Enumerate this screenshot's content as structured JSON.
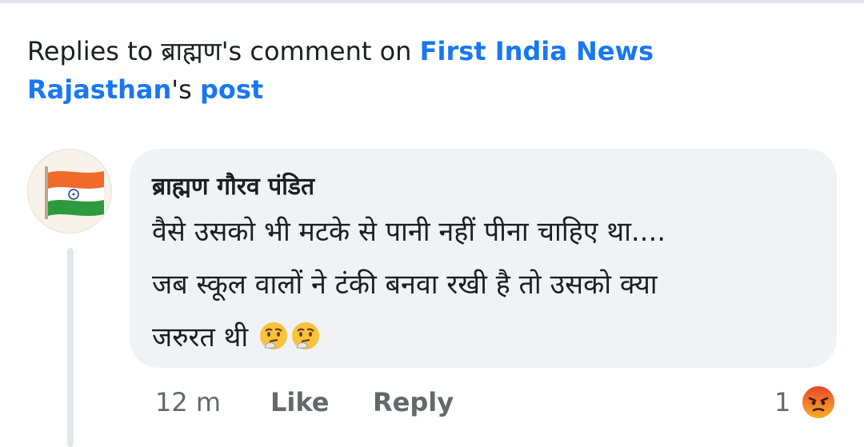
{
  "header": {
    "prefix": "Replies to ब्राह्मण's comment on ",
    "page_name_part1": "First India News",
    "page_name_part2": "Rajasthan",
    "possessive": "'s ",
    "post_link": "post"
  },
  "comment": {
    "author": "ब्राह्मण गौरव पंडित",
    "lines": [
      "वैसे उसको भी मटके से पानी नहीं पीना चाहिए था....",
      "जब स्कूल वालों ने टंकी बनवा रखी है तो उसको क्या",
      "जरुरत थी"
    ],
    "trailing_emojis": [
      "thinking-face-emoji",
      "thinking-face-emoji"
    ],
    "avatar": "indian-flag-avatar",
    "time": "12 m",
    "like_label": "Like",
    "reply_label": "Reply",
    "reaction_count": "1",
    "reaction_icon": "angry-face-icon"
  },
  "colors": {
    "link": "#1877f2",
    "bubble": "#f0f2f5",
    "meta_text": "#65676b",
    "text": "#1c1e21"
  }
}
